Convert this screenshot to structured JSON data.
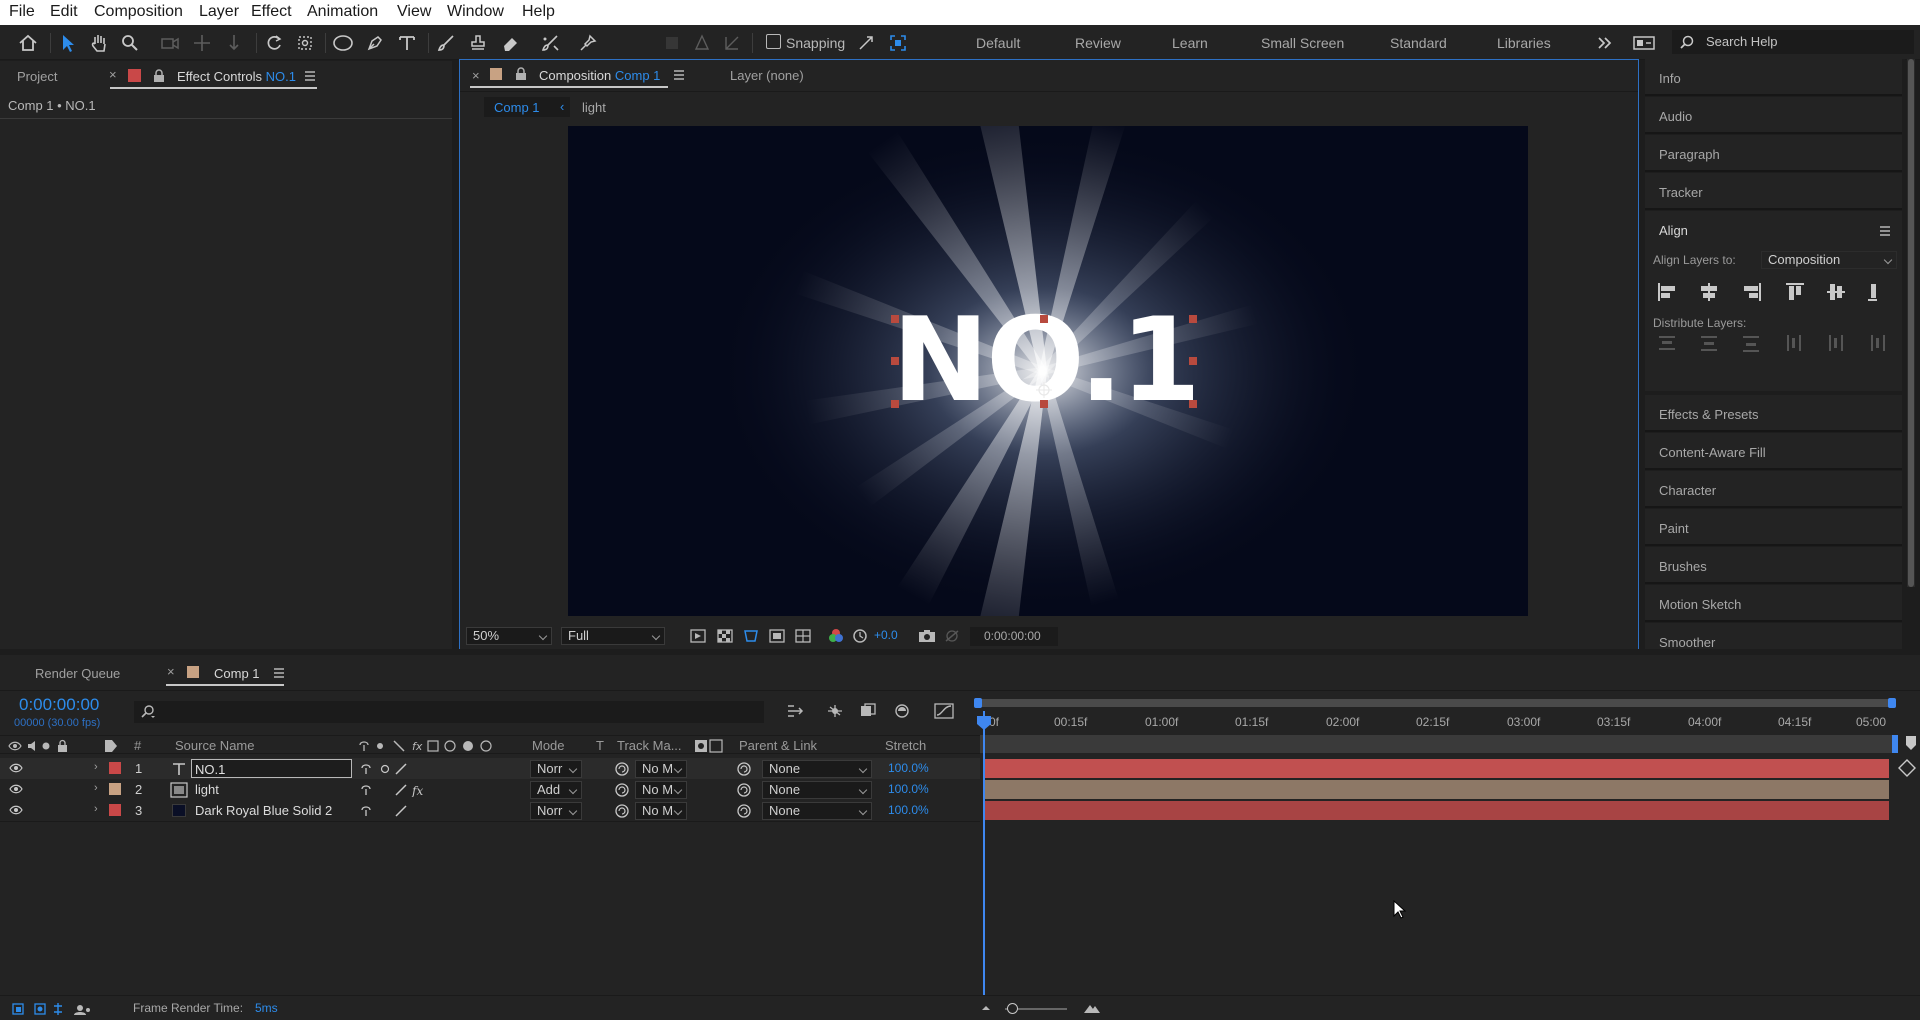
{
  "menu": [
    "File",
    "Edit",
    "Composition",
    "Layer",
    "Effect",
    "Animation",
    "View",
    "Window",
    "Help"
  ],
  "toolbar": {
    "snapping_label": "Snapping",
    "workspaces": [
      "Default",
      "Review",
      "Learn",
      "Small Screen",
      "Standard",
      "Libraries"
    ],
    "search_placeholder": "Search Help"
  },
  "left_panel": {
    "tab_project": "Project",
    "tab_effect_controls": "Effect Controls",
    "effect_controls_layer": "NO.1",
    "breadcrumb": "Comp 1 • NO.1"
  },
  "viewer": {
    "tab_composition": "Composition",
    "comp_name": "Comp 1",
    "tab_layer": "Layer (none)",
    "nav_comp": "Comp 1",
    "nav_light": "light",
    "canvas_text": "NO.1",
    "zoom": "50%",
    "resolution": "Full",
    "exposure": "+0.0",
    "timecode": "0:00:00:00"
  },
  "right_panel": {
    "items_top": [
      "Info",
      "Audio",
      "Paragraph",
      "Tracker"
    ],
    "align_title": "Align",
    "align_layers_to_label": "Align Layers to:",
    "align_layers_to_value": "Composition",
    "distribute_label": "Distribute Layers:",
    "items_bottom": [
      "Effects & Presets",
      "Content-Aware Fill",
      "Character",
      "Paint",
      "Brushes",
      "Motion Sketch",
      "Smoother"
    ]
  },
  "timeline": {
    "tab_render_queue": "Render Queue",
    "tab_comp": "Comp 1",
    "current_time": "0:00:00:00",
    "fps_info": "00000 (30.00 fps)",
    "columns": {
      "num": "#",
      "source_name": "Source Name",
      "mode": "Mode",
      "t": "T",
      "track_matte": "Track Ma...",
      "parent_link": "Parent & Link",
      "stretch": "Stretch"
    },
    "layers": [
      {
        "num": "1",
        "name": "NO.1",
        "mode": "Norr",
        "track": "No M",
        "parent": "None",
        "stretch": "100.0%",
        "label_color": "#c94848",
        "bar_color": "#c15050"
      },
      {
        "num": "2",
        "name": "light",
        "mode": "Add",
        "track": "No M",
        "parent": "None",
        "stretch": "100.0%",
        "label_color": "#c8a283",
        "bar_color": "#8d7866"
      },
      {
        "num": "3",
        "name": "Dark Royal Blue Solid 2",
        "mode": "Norr",
        "track": "No M",
        "parent": "None",
        "stretch": "100.0%",
        "label_color": "#c94848",
        "bar_color": "#a84444"
      }
    ],
    "ruler_ticks": [
      "0f",
      "00:15f",
      "01:00f",
      "01:15f",
      "02:00f",
      "02:15f",
      "03:00f",
      "03:15f",
      "04:00f",
      "04:15f",
      "05:00"
    ],
    "frame_render_label": "Frame Render Time:",
    "frame_render_value": "5ms"
  },
  "colors": {
    "accent": "#2d8ceb",
    "playhead": "#3f87f0"
  }
}
